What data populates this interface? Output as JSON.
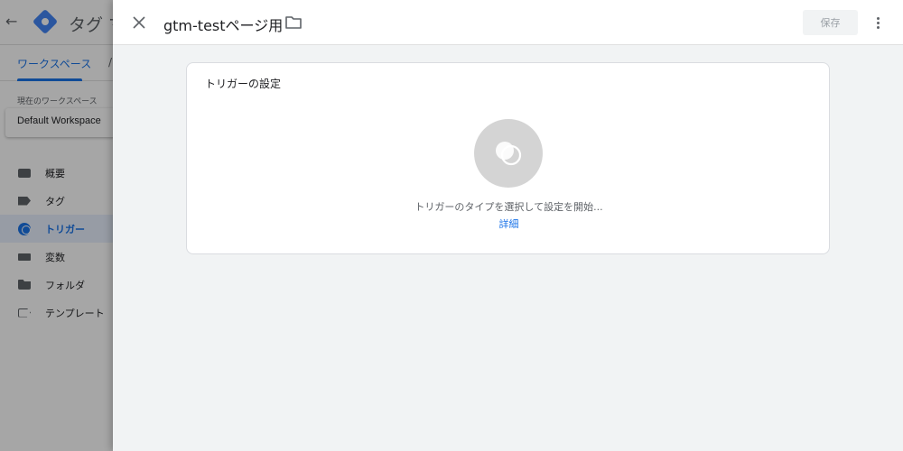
{
  "background_app": {
    "app_title": "タグ マ",
    "tabs": [
      {
        "label": "ワークスペース",
        "active": true
      },
      {
        "label": "/",
        "active": false
      }
    ],
    "workspace_label": "現在のワークスペース",
    "workspace_value": "Default Workspace",
    "nav": [
      {
        "label": "概要",
        "icon": "overview-icon",
        "active": false
      },
      {
        "label": "タグ",
        "icon": "tag-icon",
        "active": false
      },
      {
        "label": "トリガー",
        "icon": "trigger-icon",
        "active": true
      },
      {
        "label": "変数",
        "icon": "variables-icon",
        "active": false
      },
      {
        "label": "フォルダ",
        "icon": "folder-icon",
        "active": false
      },
      {
        "label": "テンプレート",
        "icon": "template-icon",
        "active": false
      }
    ]
  },
  "sheet": {
    "title": "gtm-testページ用",
    "save_label": "保存",
    "card": {
      "title": "トリガーの設定",
      "hint": "トリガーのタイプを選択して設定を開始...",
      "link": "詳細"
    }
  },
  "colors": {
    "accent": "#1a73e8",
    "page_bg": "#f1f3f4",
    "placeholder_circle": "#d4d4d4"
  }
}
